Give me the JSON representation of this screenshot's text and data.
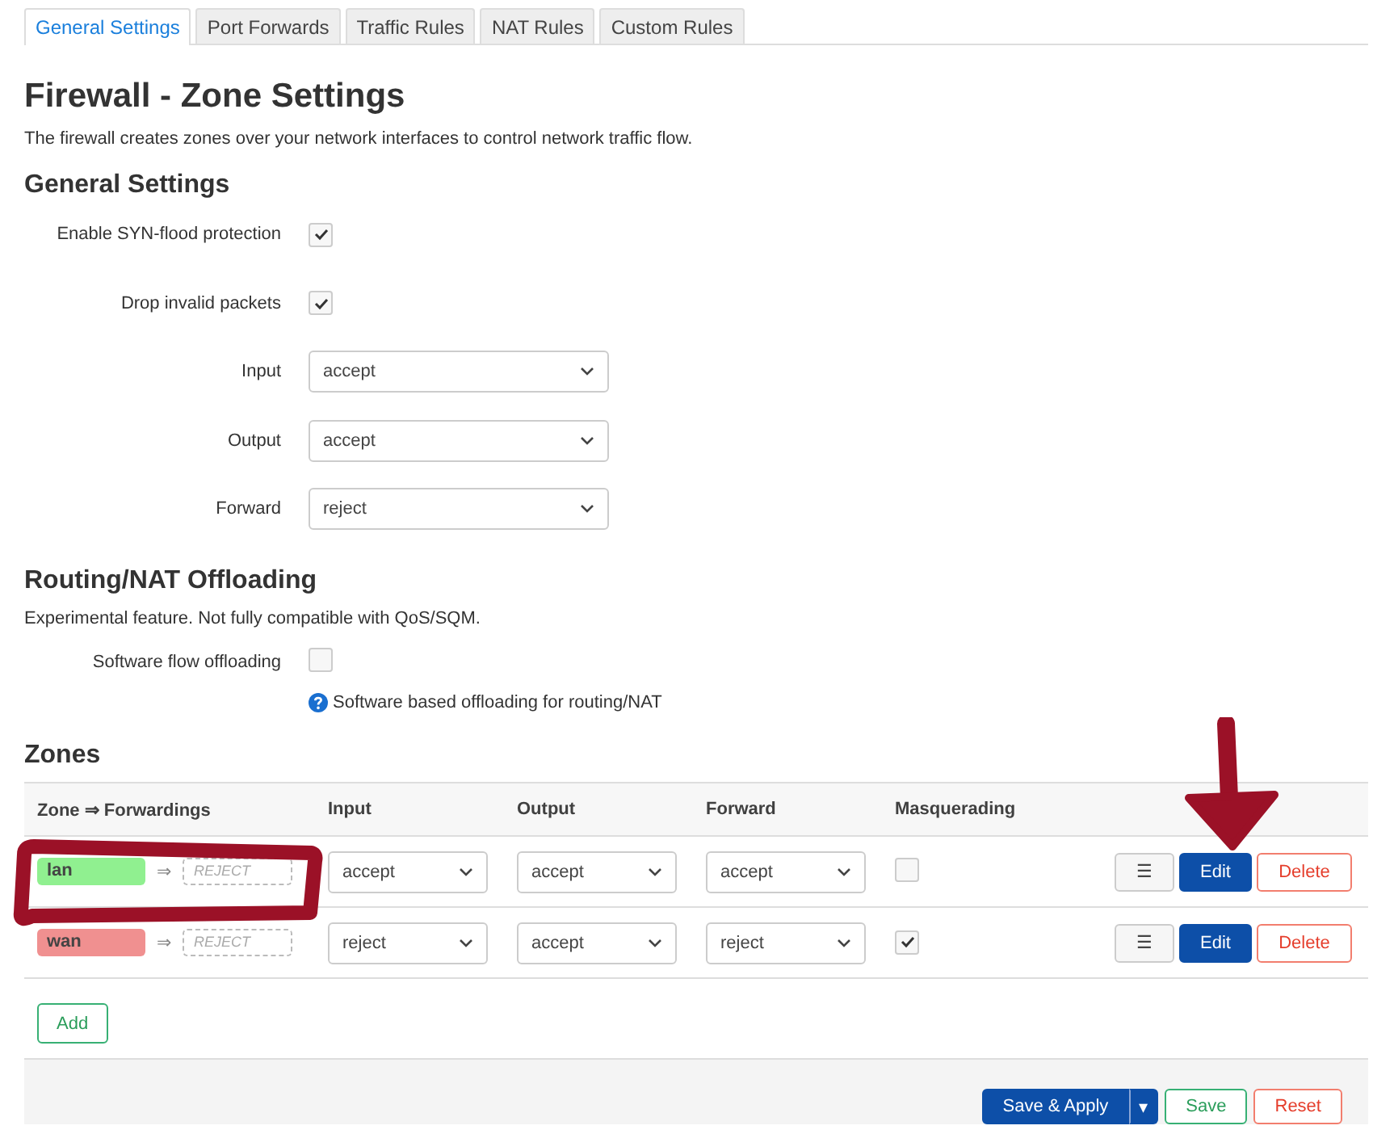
{
  "tabs": [
    {
      "label": "General Settings",
      "selected": true
    },
    {
      "label": "Port Forwards",
      "selected": false
    },
    {
      "label": "Traffic Rules",
      "selected": false
    },
    {
      "label": "NAT Rules",
      "selected": false
    },
    {
      "label": "Custom Rules",
      "selected": false
    }
  ],
  "title": "Firewall - Zone Settings",
  "description": "The firewall creates zones over your network interfaces to control network traffic flow.",
  "general": {
    "heading": "General Settings",
    "fields": [
      {
        "kind": "checkbox",
        "label": "Enable SYN-flood protection",
        "checked": true
      },
      {
        "kind": "checkbox",
        "label": "Drop invalid packets",
        "checked": true
      },
      {
        "kind": "select",
        "label": "Input",
        "value": "accept"
      },
      {
        "kind": "select",
        "label": "Output",
        "value": "accept"
      },
      {
        "kind": "select",
        "label": "Forward",
        "value": "reject"
      }
    ]
  },
  "offloading": {
    "heading": "Routing/NAT Offloading",
    "note": "Experimental feature. Not fully compatible with QoS/SQM.",
    "fields": [
      {
        "kind": "checkbox",
        "label": "Software flow offloading",
        "checked": false,
        "help": "Software based offloading for routing/NAT"
      }
    ]
  },
  "zones": {
    "heading": "Zones",
    "columns": [
      "Zone ⇒ Forwardings",
      "Input",
      "Output",
      "Forward",
      "Masquerading"
    ],
    "rows": [
      {
        "name": "lan",
        "color": "#90f090",
        "arrow": "⇒",
        "target": "REJECT",
        "input": "accept",
        "output": "accept",
        "forward": "accept",
        "masquerading": false,
        "highlighted": true,
        "pointed": true,
        "actions": [
          {
            "kind": "menu",
            "label": "☰"
          },
          {
            "kind": "edit",
            "label": "Edit"
          },
          {
            "kind": "delete",
            "label": "Delete"
          }
        ]
      },
      {
        "name": "wan",
        "color": "#f09090",
        "arrow": "⇒",
        "target": "REJECT",
        "input": "reject",
        "output": "accept",
        "forward": "reject",
        "masquerading": true,
        "highlighted": false,
        "pointed": false,
        "actions": [
          {
            "kind": "menu",
            "label": "☰"
          },
          {
            "kind": "edit",
            "label": "Edit"
          },
          {
            "kind": "delete",
            "label": "Delete"
          }
        ]
      }
    ],
    "add_button": "Add"
  },
  "footer": {
    "buttons": [
      {
        "kind": "primary",
        "label": "Save & Apply"
      },
      {
        "kind": "dropdown",
        "label": "▾"
      },
      {
        "kind": "save",
        "label": "Save"
      },
      {
        "kind": "reset",
        "label": "Reset"
      }
    ]
  }
}
